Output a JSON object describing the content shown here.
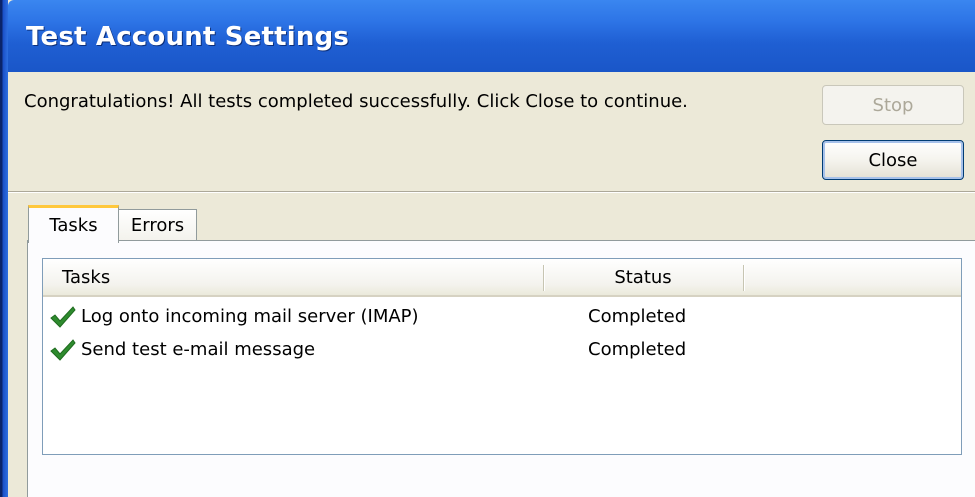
{
  "window": {
    "title": "Test Account Settings"
  },
  "message": "Congratulations! All tests completed successfully. Click Close to continue.",
  "buttons": {
    "stop_label": "Stop",
    "close_label": "Close"
  },
  "tabs": [
    {
      "label": "Tasks",
      "active": true
    },
    {
      "label": "Errors",
      "active": false
    }
  ],
  "list": {
    "columns": [
      "Tasks",
      "Status"
    ],
    "rows": [
      {
        "icon": "check-icon",
        "task": "Log onto incoming mail server (IMAP)",
        "status": "Completed"
      },
      {
        "icon": "check-icon",
        "task": "Send test e-mail message",
        "status": "Completed"
      }
    ]
  },
  "colors": {
    "titlebar": "#2d74e6",
    "window_bg": "#ece9d8",
    "active_tab_accent": "#ffc83c",
    "check_green": "#2e8b2e"
  }
}
